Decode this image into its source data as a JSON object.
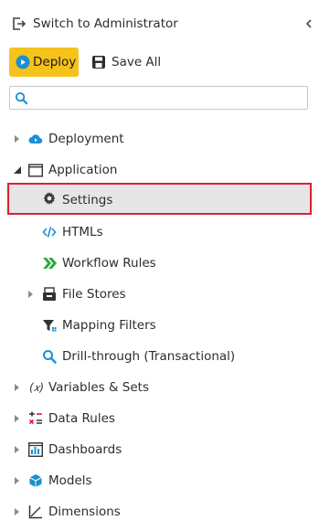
{
  "header": {
    "switch_label": "Switch to Administrator"
  },
  "toolbar": {
    "deploy_label": "Deploy",
    "save_all_label": "Save All"
  },
  "search": {
    "placeholder": "",
    "value": ""
  },
  "colors": {
    "accent_yellow": "#f6c21c",
    "selection_bg": "#e6e6e6",
    "highlight_border": "#d9232e",
    "icon_blue": "#1a8fd1",
    "icon_green": "#2eaa3b"
  },
  "tree": {
    "deployment": "Deployment",
    "application": "Application",
    "settings": "Settings",
    "htmls": "HTMLs",
    "workflow_rules": "Workflow Rules",
    "file_stores": "File Stores",
    "mapping_filters": "Mapping Filters",
    "drill_through": "Drill-through (Transactional)",
    "variables_sets": "Variables & Sets",
    "data_rules": "Data Rules",
    "dashboards": "Dashboards",
    "models": "Models",
    "dimensions": "Dimensions"
  }
}
